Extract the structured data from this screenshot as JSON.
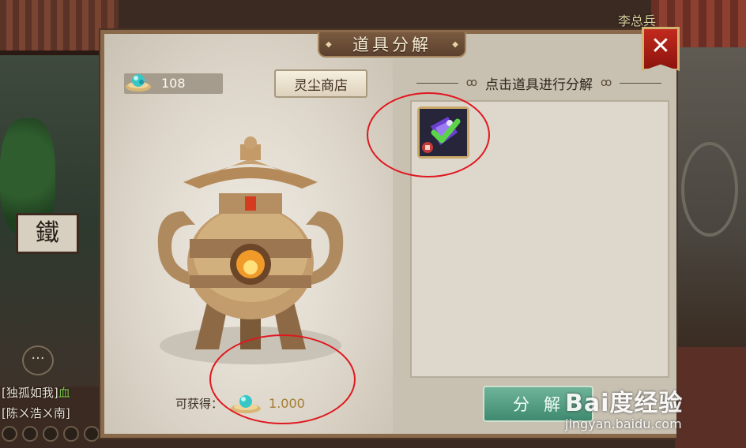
{
  "scene": {
    "npc_name": "李总兵",
    "sign_text": "鐵",
    "chat_icon": "···",
    "chat": [
      {
        "name": "[独孤如我]",
        "tail": "血"
      },
      {
        "name": "[陈ㄨ浩ㄨ南]",
        "tail": ""
      }
    ]
  },
  "panel": {
    "title": "道具分解",
    "close_label": "✕",
    "dust_count": "108",
    "shop_label": "灵尘商店",
    "reward_label": "可获得：",
    "reward_value": "1.000",
    "instruction": "点击道具进行分解",
    "decompose_label": "分解",
    "items": [
      {
        "icon": "crystal-item-icon",
        "selected": true,
        "badge": "bound-badge"
      }
    ]
  },
  "watermark": {
    "brand": "Bai度经验",
    "url": "jingyan.baidu.com"
  },
  "colors": {
    "annotation": "#e0171f",
    "decompose_button": "#4f9c80",
    "close_button": "#b22418"
  }
}
